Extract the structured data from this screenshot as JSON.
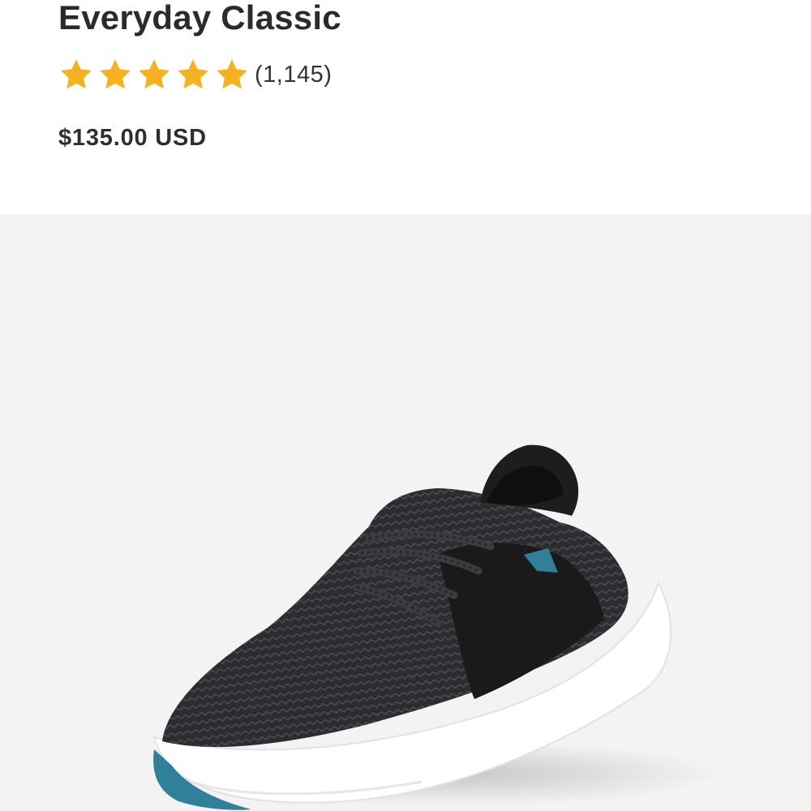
{
  "product": {
    "title": "Everyday Classic",
    "rating": 5,
    "rating_max": 5,
    "review_count": "(1,145)",
    "price": "$135.00 USD"
  },
  "colors": {
    "star": "#F5B120",
    "title": "#2B2B2B",
    "gallery_background": "#F3F3F3",
    "shoe_knit": "#2E3033",
    "shoe_suede": "#1A1A1A",
    "sole": "#FFFFFF",
    "accent_teal": "#2F8098"
  },
  "gallery": {
    "image": "black-knit-sneaker"
  }
}
